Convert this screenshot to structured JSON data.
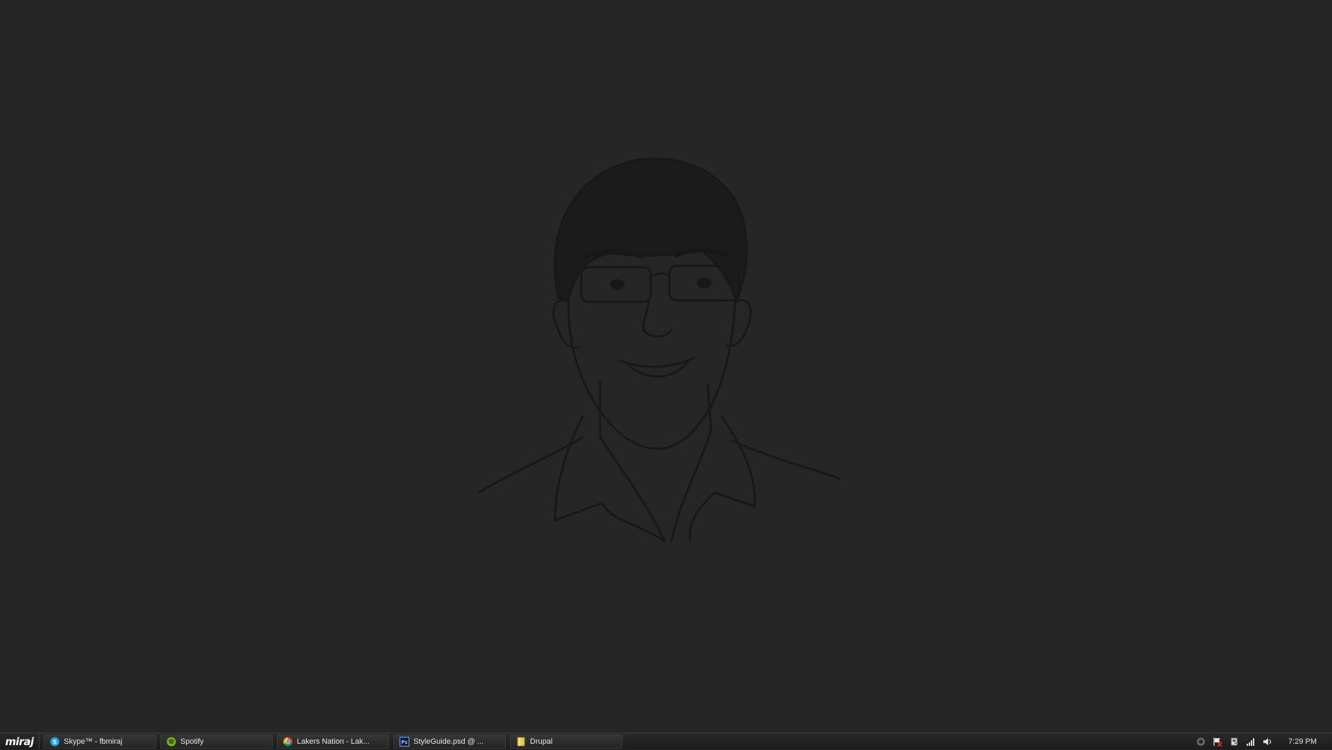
{
  "start": {
    "label": "miraj"
  },
  "taskbar": {
    "items": [
      {
        "label": "Skype™ - fbmiraj",
        "icon": "skype-icon"
      },
      {
        "label": "Spotify",
        "icon": "spotify-icon"
      },
      {
        "label": "Lakers Nation - Lak...",
        "icon": "chrome-icon"
      },
      {
        "label": "StyleGuide.psd @ ...",
        "icon": "photoshop-icon"
      },
      {
        "label": "Drupal",
        "icon": "folder-icon"
      }
    ]
  },
  "tray": {
    "icons": [
      "record-icon",
      "flag-icon",
      "safely-remove-icon",
      "network-signal-icon",
      "volume-icon"
    ],
    "clock": "7:29 PM"
  },
  "colors": {
    "desktop_background": "#262626",
    "taskbar": "#1f1f1f",
    "sketch_line": "#181818"
  }
}
